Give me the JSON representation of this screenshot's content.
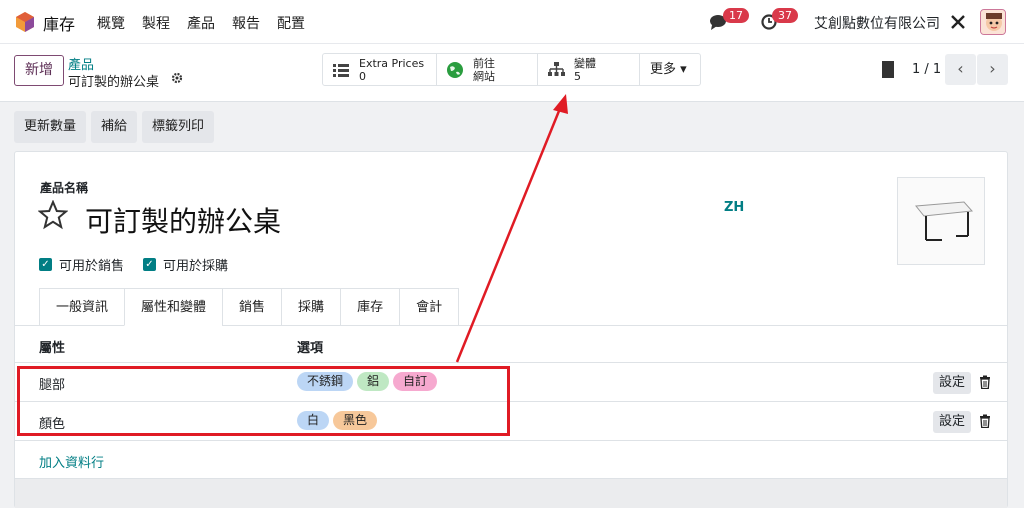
{
  "topbar": {
    "app_name": "庫存",
    "menu": [
      "概覽",
      "製程",
      "產品",
      "報告",
      "配置"
    ],
    "chat_badge": "17",
    "activity_badge": "37",
    "company": "艾創點數位有限公司"
  },
  "control": {
    "new_label": "新增",
    "breadcrumb_parent": "產品",
    "breadcrumb_current": "可訂製的辦公桌",
    "smart_buttons": [
      {
        "line1": "Extra Prices",
        "line2": "0"
      },
      {
        "line1": "前往",
        "line2": "網站"
      },
      {
        "line1": "變體",
        "line2": "5"
      }
    ],
    "more_label": "更多 ▾",
    "pager": "1 / 1",
    "prev_icon": "‹",
    "next_icon": "›"
  },
  "actions": [
    "更新數量",
    "補給",
    "標籤列印"
  ],
  "form": {
    "name_label": "產品名稱",
    "product_name": "可訂製的辦公桌",
    "lang": "ZH",
    "can_sell": "可用於銷售",
    "can_purchase": "可用於採購",
    "tabs": [
      "一般資訊",
      "屬性和變體",
      "銷售",
      "採購",
      "庫存",
      "會計"
    ],
    "col_attribute": "屬性",
    "col_values": "選項",
    "rows": [
      {
        "attribute": "腿部",
        "values": [
          "不銹鋼",
          "鋁",
          "自訂"
        ],
        "set_label": "設定"
      },
      {
        "attribute": "顏色",
        "values": [
          "白",
          "黑色"
        ],
        "set_label": "設定"
      }
    ],
    "add_line": "加入資料行"
  },
  "colors": {
    "teal": "#017e84",
    "highlight_red": "#e01b24",
    "tag_blue": "#bcd6f5",
    "tag_green": "#bfe8c3",
    "tag_pink": "#f6a9cf",
    "tag_orange": "#f7c89a"
  }
}
